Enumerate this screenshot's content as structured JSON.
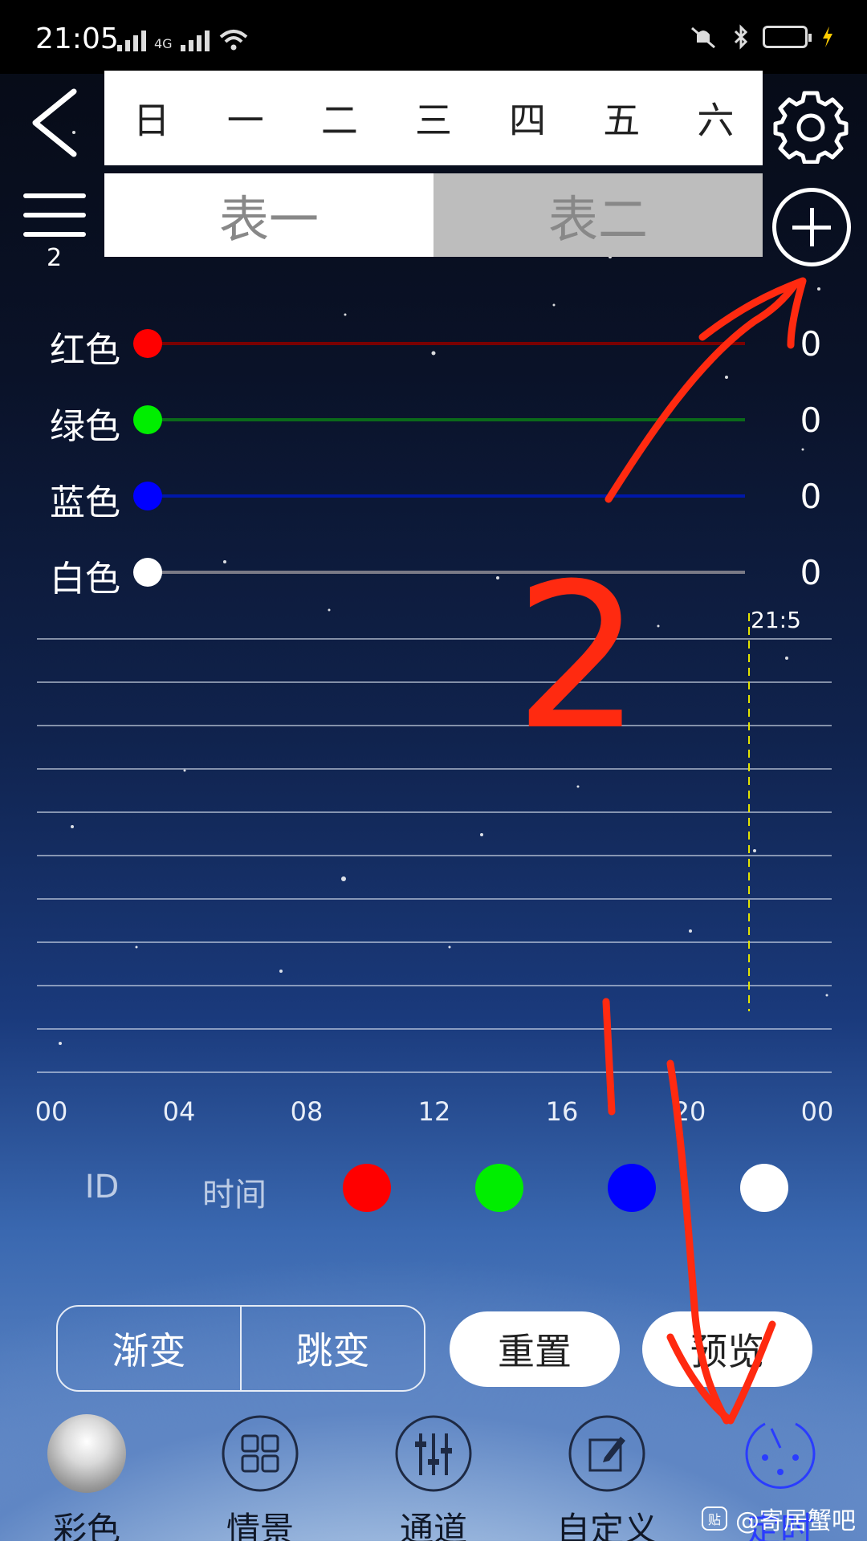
{
  "status_bar": {
    "time": "21:05",
    "network": "4G"
  },
  "header": {
    "days": [
      "日",
      "一",
      "二",
      "三",
      "四",
      "五",
      "六"
    ],
    "tables": [
      "表一",
      "表二"
    ],
    "active_table_index": 1,
    "menu_count": "2"
  },
  "sliders": [
    {
      "label": "红色",
      "value": "0",
      "color": "#ff0000",
      "track_color": "#7a0000"
    },
    {
      "label": "绿色",
      "value": "0",
      "color": "#00ee00",
      "track_color": "#0b6a1a"
    },
    {
      "label": "蓝色",
      "value": "0",
      "color": "#0000ff",
      "track_color": "#0018a8"
    },
    {
      "label": "白色",
      "value": "0",
      "color": "#ffffff",
      "track_color": "#7a7a86"
    }
  ],
  "timeline": {
    "now_label": "21:5",
    "now_position": 0.896,
    "x_ticks": [
      "00",
      "04",
      "08",
      "12",
      "16",
      "20",
      "00"
    ],
    "gridline_count": 11,
    "marker_color": "#e6e600"
  },
  "columns": {
    "id": "ID",
    "time": "时间",
    "colors": [
      "#ff0000",
      "#00ee00",
      "#0000ff",
      "#ffffff"
    ]
  },
  "mode_buttons": [
    "渐变",
    "跳变"
  ],
  "action_buttons": [
    "重置",
    "预览"
  ],
  "nav": {
    "items": [
      "彩色",
      "情景",
      "通道",
      "自定义",
      "定时"
    ],
    "active_index": 4,
    "active_color": "#2a3cff"
  },
  "watermark": {
    "badge": "贴",
    "text": "@寄居蟹吧"
  },
  "annotations": {
    "color": "#ff2a10",
    "step_2": "2"
  }
}
